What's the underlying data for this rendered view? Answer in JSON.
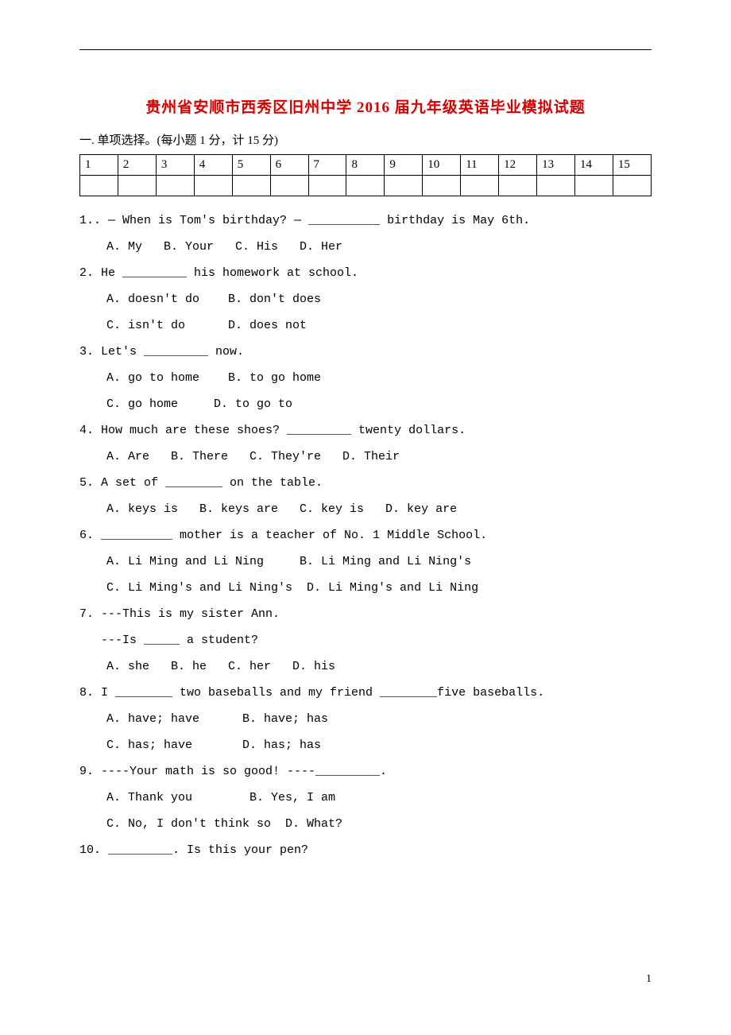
{
  "title": "贵州省安顺市西秀区旧州中学 2016 届九年级英语毕业模拟试题",
  "section1": "一. 单项选择。(每小题 1 分，计 15 分)",
  "grid": [
    "1",
    "2",
    "3",
    "4",
    "5",
    "6",
    "7",
    "8",
    "9",
    "10",
    "11",
    "12",
    "13",
    "14",
    "15"
  ],
  "q1": "1.. — When is Tom's birthday? — __________ birthday is May 6th.",
  "q1o": "A. My   B. Your   C. His   D. Her",
  "q2": "2. He _________ his homework at school.",
  "q2oA": "A. doesn't do    B. don't does",
  "q2oB": "C. isn't do      D. does not",
  "q3": "3. Let's _________ now.",
  "q3oA": "A. go to home    B. to go home",
  "q3oB": "C. go home     D. to go to",
  "q4": "4. How much are these shoes? _________ twenty dollars.",
  "q4o": "A. Are   B. There   C. They're   D. Their",
  "q5": "5. A set of ________ on the table.",
  "q5o": "A. keys is   B. keys are   C. key is   D. key are",
  "q6": "6. __________ mother is a teacher of No. 1 Middle School.",
  "q6oA": "A. Li Ming and Li Ning     B. Li Ming and Li Ning's",
  "q6oB": "C. Li Ming's and Li Ning's  D. Li Ming's and Li Ning",
  "q7": "7. ---This is my sister Ann.",
  "q7b": "   ---Is _____ a student?",
  "q7o": "A. she   B. he   C. her   D. his",
  "q8": "8. I ________ two baseballs and my friend ________five baseballs.",
  "q8oA": "A. have; have      B. have; has",
  "q8oB": "C. has; have       D. has; has",
  "q9": "9. ----Your math is so good! ----_________.",
  "q9oA": "A. Thank you        B. Yes, I am",
  "q9oB": "C. No, I don't think so  D. What?",
  "q10": "10. _________. Is this your pen?",
  "pageNum": "1"
}
